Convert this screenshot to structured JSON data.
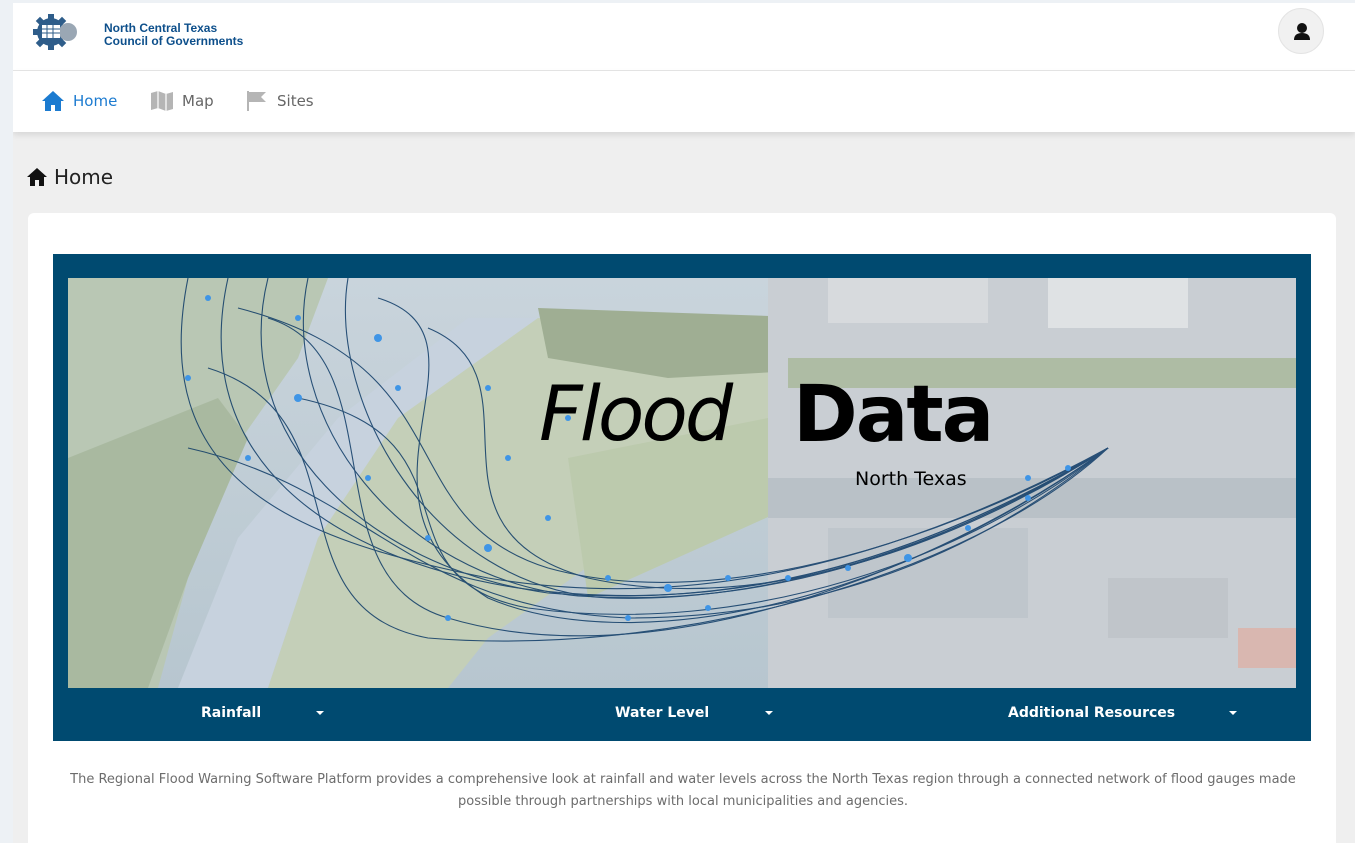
{
  "org": {
    "name_line1": "North Central Texas",
    "name_line2": "Council of Governments"
  },
  "nav": {
    "items": [
      {
        "label": "Home",
        "icon": "home-icon",
        "active": true
      },
      {
        "label": "Map",
        "icon": "map-icon",
        "active": false
      },
      {
        "label": "Sites",
        "icon": "flag-icon",
        "active": false
      }
    ]
  },
  "page": {
    "title": "Home"
  },
  "hero": {
    "title_italic": "Flood",
    "title_bold": "Data",
    "subtitle": "North Texas",
    "menus": [
      {
        "label": "Rainfall"
      },
      {
        "label": "Water Level"
      },
      {
        "label": "Additional Resources"
      }
    ]
  },
  "description": "The Regional Flood Warning Software Platform provides a comprehensive look at rainfall and water levels across the North Texas region through a connected network of flood gauges made possible through partnerships with local municipalities and agencies.",
  "colors": {
    "accent": "#1c7bd0",
    "hero_frame": "#004a70",
    "logo": "#0d4f8b"
  }
}
